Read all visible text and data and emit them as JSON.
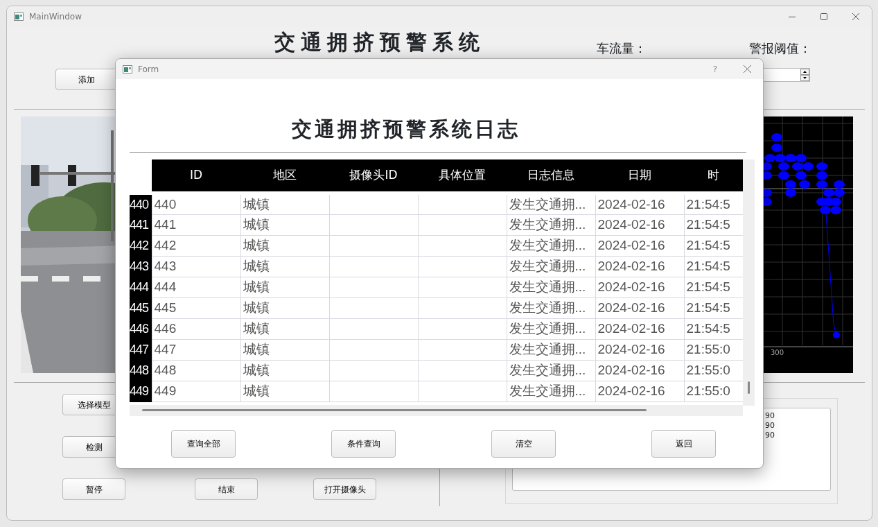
{
  "main_window": {
    "title": "MainWindow",
    "app_title": "交通拥挤预警系统",
    "traffic_label": "车流量：",
    "threshold_label": "警报阈值：",
    "add_button": "添加",
    "video": {
      "kind": "picture"
    },
    "chart": {
      "x_tick": "300"
    },
    "control_rows": [
      [
        "选择模型"
      ],
      [
        "检测"
      ],
      [
        "暂停",
        "结束",
        "打开摄像头"
      ]
    ],
    "log_lines": [
      "90",
      "90",
      "90"
    ]
  },
  "dialog": {
    "title": "Form",
    "help_button": "?",
    "heading": "交通拥挤预警系统日志",
    "table": {
      "columns": [
        "ID",
        "地区",
        "摄像头ID",
        "具体位置",
        "日志信息",
        "日期",
        "时"
      ],
      "rows": [
        {
          "header": "440",
          "id": "440",
          "region": "城镇",
          "log": "发生交通拥...",
          "date": "2024-02-16",
          "time": "21:54:5"
        },
        {
          "header": "441",
          "id": "441",
          "region": "城镇",
          "log": "发生交通拥...",
          "date": "2024-02-16",
          "time": "21:54:5"
        },
        {
          "header": "442",
          "id": "442",
          "region": "城镇",
          "log": "发生交通拥...",
          "date": "2024-02-16",
          "time": "21:54:5"
        },
        {
          "header": "443",
          "id": "443",
          "region": "城镇",
          "log": "发生交通拥...",
          "date": "2024-02-16",
          "time": "21:54:5"
        },
        {
          "header": "444",
          "id": "444",
          "region": "城镇",
          "log": "发生交通拥...",
          "date": "2024-02-16",
          "time": "21:54:5"
        },
        {
          "header": "445",
          "id": "445",
          "region": "城镇",
          "log": "发生交通拥...",
          "date": "2024-02-16",
          "time": "21:54:5"
        },
        {
          "header": "446",
          "id": "446",
          "region": "城镇",
          "log": "发生交通拥...",
          "date": "2024-02-16",
          "time": "21:54:5"
        },
        {
          "header": "447",
          "id": "447",
          "region": "城镇",
          "log": "发生交通拥...",
          "date": "2024-02-16",
          "time": "21:55:0"
        },
        {
          "header": "448",
          "id": "448",
          "region": "城镇",
          "log": "发生交通拥...",
          "date": "2024-02-16",
          "time": "21:55:0"
        },
        {
          "header": "449",
          "id": "449",
          "region": "城镇",
          "log": "发生交通拥...",
          "date": "2024-02-16",
          "time": "21:55:0"
        }
      ]
    },
    "buttons": [
      "查询全部",
      "条件查询",
      "清空",
      "返回"
    ]
  }
}
